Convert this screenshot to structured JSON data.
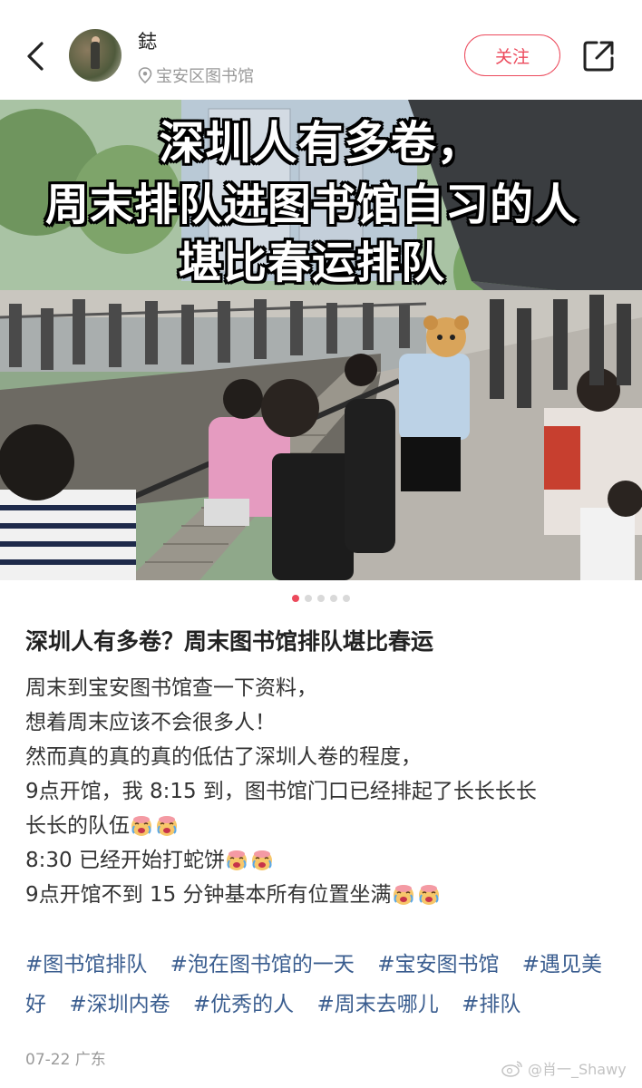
{
  "header": {
    "username": "鋕",
    "location": "宝安区图书馆",
    "follow_label": "关注"
  },
  "photo": {
    "overlay_line1": "深圳人有多卷，",
    "overlay_line2": "周末排队进图书馆自习的人",
    "overlay_line3": "堪比春运排队",
    "dots_total": 5,
    "dots_active": 1
  },
  "post": {
    "title": "深圳人有多卷？周末图书馆排队堪比春运",
    "lines": [
      "周末到宝安图书馆查一下资料，",
      "想着周末应该不会很多人！",
      "然而真的真的真的低估了深圳人卷的程度，",
      "9点开馆，我 8:15 到，图书馆门口已经排起了长长长长",
      "长长的队伍",
      "8:30 已经开始打蛇饼",
      "9点开馆不到 15 分钟基本所有位置坐满"
    ],
    "tags": [
      "#图书馆排队",
      "#泡在图书馆的一天",
      "#宝安图书馆",
      "#遇见美好",
      "#深圳内卷",
      "#优秀的人",
      "#周末去哪儿",
      "#排队"
    ],
    "date_location": "07-22 广东"
  },
  "watermark": "@肖一_Shawy",
  "icons": {
    "back": "chevron-left-icon",
    "location": "location-pin-icon",
    "share": "share-icon",
    "emoji": "crying-face-emoji-icon",
    "weibo": "weibo-logo-icon"
  },
  "colors": {
    "accent": "#ec4a5c",
    "tag": "#3a5d8f",
    "muted": "#9a9a9a"
  }
}
